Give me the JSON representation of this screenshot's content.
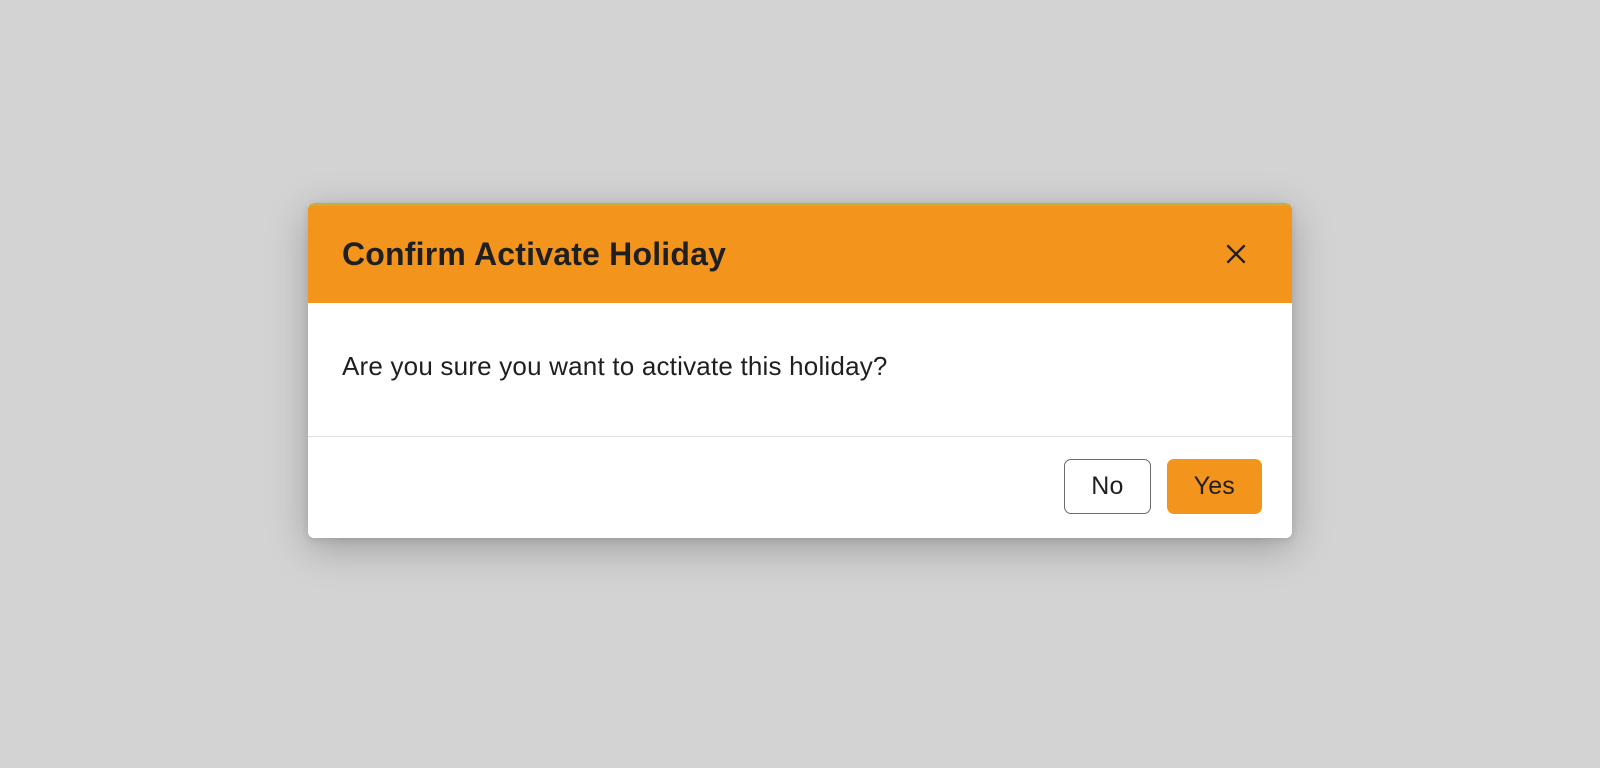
{
  "dialog": {
    "title": "Confirm Activate Holiday",
    "message": "Are you sure you want to activate this holiday?",
    "buttons": {
      "no": "No",
      "yes": "Yes"
    }
  },
  "colors": {
    "accent": "#f3941c",
    "background": "#d3d3d3",
    "text": "#1f1f1f"
  }
}
